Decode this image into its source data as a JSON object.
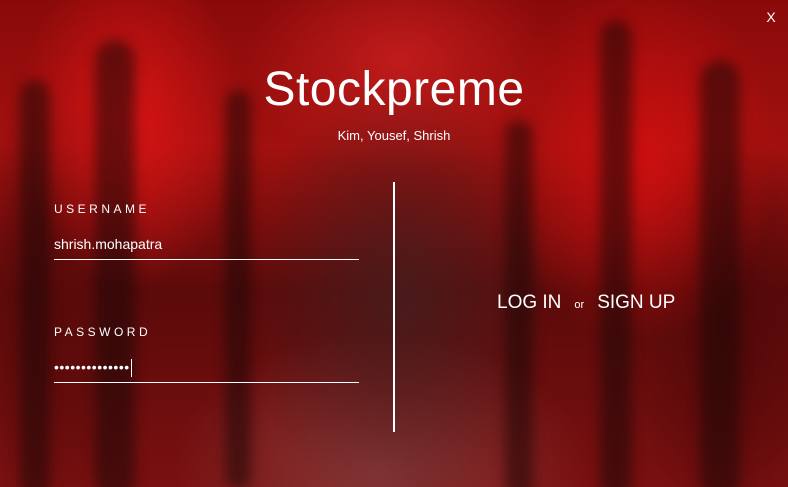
{
  "window": {
    "close_label": "X"
  },
  "header": {
    "title": "Stockpreme",
    "subtitle": "Kim, Yousef, Shrish"
  },
  "login_form": {
    "username_label": "USERNAME",
    "username_value": "shrish.mohapatra",
    "password_label": "PASSWORD",
    "password_masked": "••••••••••••••"
  },
  "actions": {
    "login_label": "LOG IN",
    "or_label": "or",
    "signup_label": "SIGN UP"
  },
  "colors": {
    "background_accent": "#a1110f",
    "text": "#ffffff"
  }
}
